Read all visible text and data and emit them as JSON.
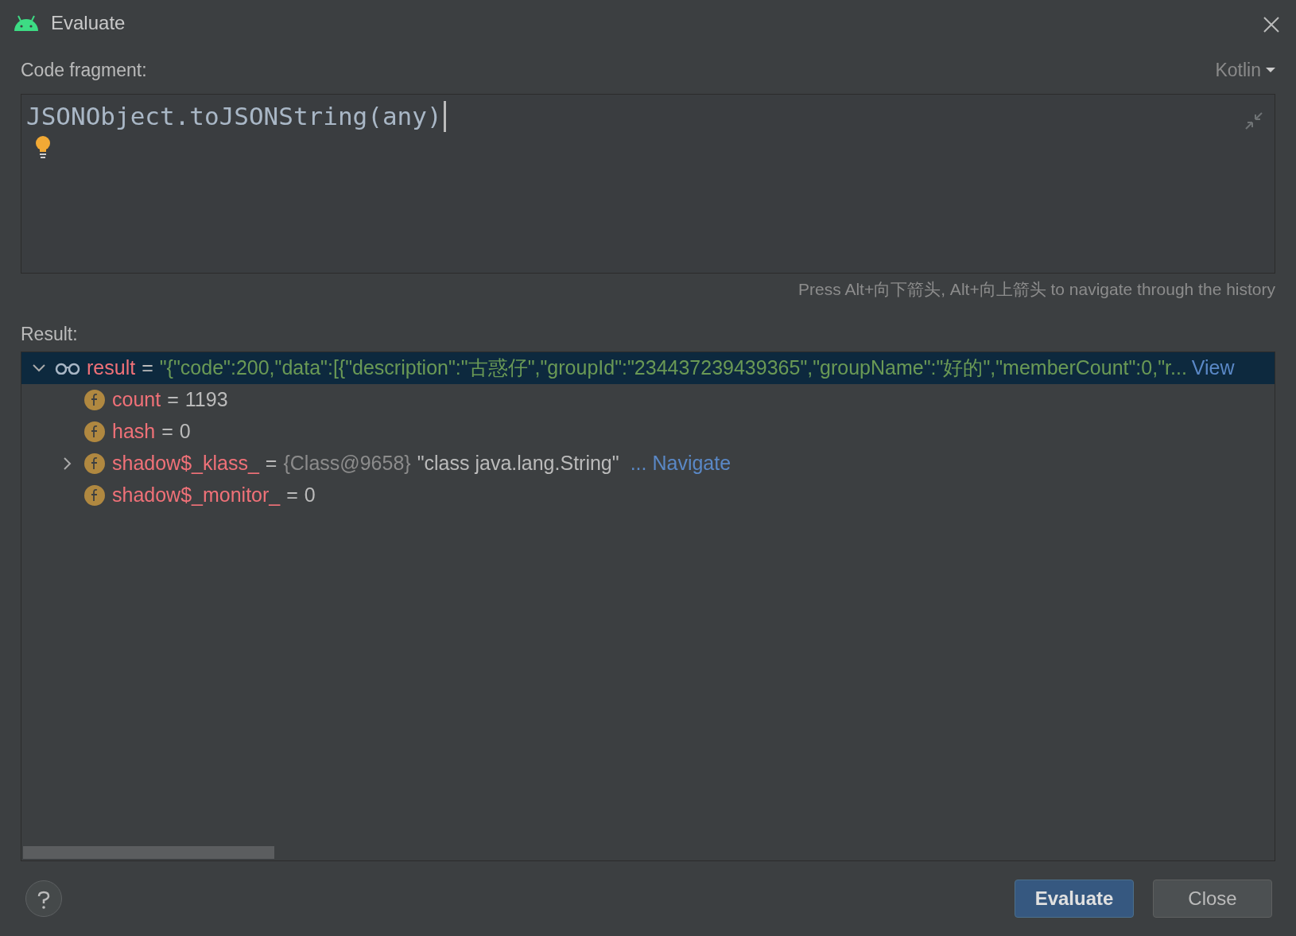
{
  "window": {
    "title": "Evaluate"
  },
  "code_fragment": {
    "label": "Code fragment:",
    "language": "Kotlin",
    "code": "JSONObject.toJSONString(any)"
  },
  "history_hint": "Press Alt+向下箭头, Alt+向上箭头 to navigate through the history",
  "result": {
    "label": "Result:",
    "tree": [
      {
        "kind": "result",
        "name": "result",
        "separator": "=",
        "expanded": true,
        "selected": true,
        "value": [
          {
            "kind": "string",
            "text": "\"{\"code\":200,\"data\":[{\"description\":\"古惑仔\",\"groupId\":\"234437239439365\",\"groupName\":\"好的\",\"memberCount\":0,\"r..."
          },
          {
            "kind": "link",
            "text": "View"
          }
        ],
        "children": [
          {
            "kind": "field",
            "name": "count",
            "separator": "=",
            "expanded": false,
            "selected": false,
            "value": [
              {
                "kind": "plain",
                "text": "1193"
              }
            ]
          },
          {
            "kind": "field",
            "name": "hash",
            "separator": "=",
            "expanded": false,
            "selected": false,
            "value": [
              {
                "kind": "plain",
                "text": "0"
              }
            ]
          },
          {
            "kind": "field",
            "name": "shadow$_klass_",
            "separator": "=",
            "expanded": false,
            "expandable": true,
            "selected": false,
            "value": [
              {
                "kind": "ref",
                "text": "{Class@9658}"
              },
              {
                "kind": "plain",
                "text": "\"class java.lang.String\""
              },
              {
                "kind": "link",
                "text": "... Navigate"
              }
            ]
          },
          {
            "kind": "field",
            "name": "shadow$_monitor_",
            "separator": "=",
            "expanded": false,
            "selected": false,
            "value": [
              {
                "kind": "plain",
                "text": "0"
              }
            ]
          }
        ]
      }
    ]
  },
  "buttons": [
    {
      "label": "Evaluate",
      "default": true
    },
    {
      "label": "Close",
      "default": false
    }
  ]
}
